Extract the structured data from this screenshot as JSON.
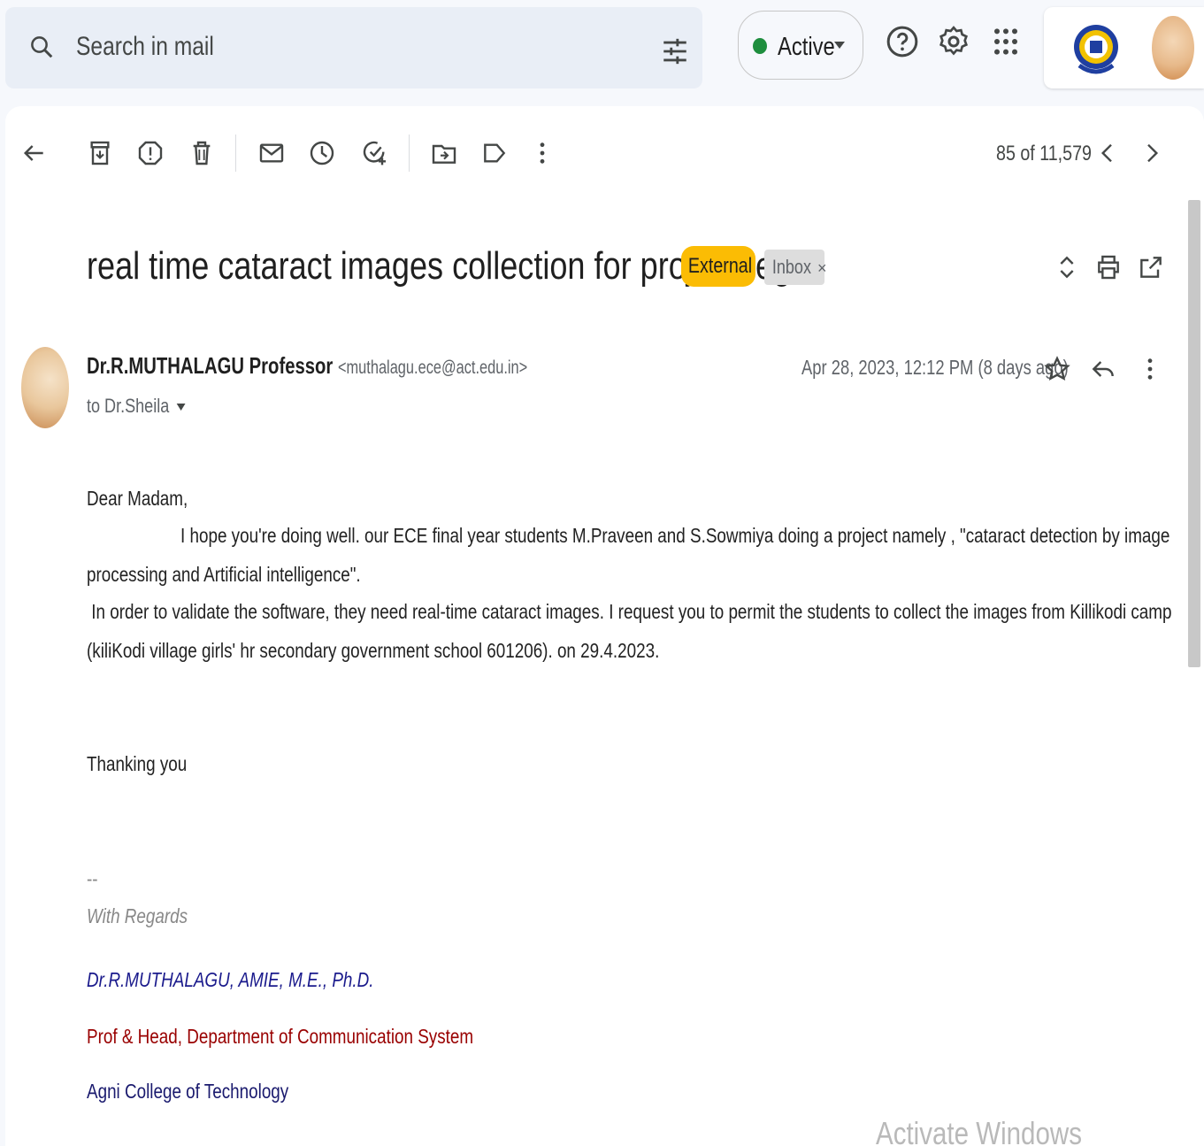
{
  "search": {
    "placeholder": "Search in mail"
  },
  "status": {
    "label": "Active",
    "color": "#1e8e3e"
  },
  "header_icons": [
    "help-icon",
    "settings-icon",
    "apps-grid-icon"
  ],
  "toolbar": {
    "icons": [
      "back-arrow-icon",
      "archive-icon",
      "report-spam-icon",
      "delete-icon",
      "mark-unread-icon",
      "snooze-icon",
      "add-to-tasks-icon",
      "move-to-icon",
      "label-icon",
      "more-icon"
    ],
    "page_count": "85 of 11,579"
  },
  "email": {
    "subject": "real time cataract images collection for project reg",
    "labels": {
      "external": "External",
      "inbox": "Inbox",
      "inbox_remove": "×"
    },
    "sender_name": "Dr.R.MUTHALAGU Professor",
    "sender_email": "<muthalagu.ece@act.edu.in>",
    "to": "to Dr.Sheila",
    "date": "Apr 28, 2023, 12:12 PM (8 days ago)",
    "body": {
      "greeting": "Dear Madam,",
      "line1": "I hope you're doing well. our ECE   final year students M.Praveen and S.Sowmiya doing a project namely , \"cataract detection by image",
      "line2": "processing and Artificial intelligence\".",
      "line3": " In order to validate the software, they need real-time cataract images. I request you to permit the students to collect the images from Killikodi camp",
      "line4": "(kiliKodi village girls' hr secondary government school 601206). on 29.4.2023.",
      "closing": "Thanking you"
    },
    "signature": {
      "dash": "--",
      "regards": "With Regards",
      "name": "Dr.R.MUTHALAGU, AMIE, M.E., Ph.D.",
      "title": "Prof & Head, Department of Communication System",
      "college": "Agni College of Technology"
    }
  },
  "watermark": "Activate Windows",
  "colors": {
    "external_badge": "#fbbc04",
    "signature_name": "#1a1a8c",
    "signature_title": "#990000"
  }
}
